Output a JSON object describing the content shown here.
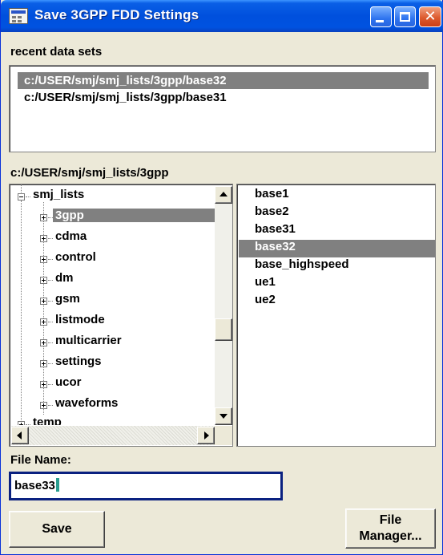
{
  "window": {
    "title": "Save 3GPP FDD Settings",
    "controls": [
      "minimize",
      "maximize",
      "close"
    ]
  },
  "recent": {
    "label": "recent data sets",
    "items": [
      "c:/USER/smj/smj_lists/3gpp/base32",
      "c:/USER/smj/smj_lists/3gpp/base31"
    ],
    "selected_index": 0
  },
  "current_path": "c:/USER/smj/smj_lists/3gpp",
  "tree": {
    "root": "smj_lists",
    "children": [
      "3gpp",
      "cdma",
      "control",
      "dm",
      "gsm",
      "listmode",
      "multicarrier",
      "settings",
      "ucor",
      "waveforms"
    ],
    "selected": "3gpp",
    "partial_next": "temp"
  },
  "files": {
    "items": [
      "base1",
      "base2",
      "base31",
      "base32",
      "base_highspeed",
      "ue1",
      "ue2"
    ],
    "selected": "base32"
  },
  "file_name": {
    "label": "File Name:",
    "value": "base33"
  },
  "buttons": {
    "save": "Save",
    "file_manager_line1": "File",
    "file_manager_line2": "Manager..."
  },
  "colors": {
    "titlebar": "#0050dd",
    "selection": "#808080",
    "input_border": "#0a2180",
    "dialog_bg": "#ece9d8"
  }
}
